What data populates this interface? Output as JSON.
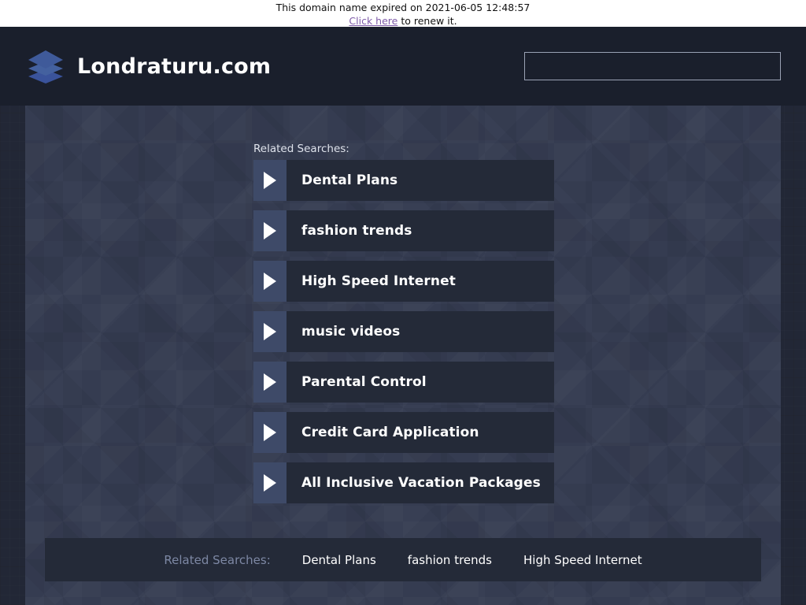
{
  "notice": {
    "message": "This domain name expired on 2021-06-05 12:48:57",
    "link_text": "Click here",
    "after_link_text": " to renew it."
  },
  "header": {
    "logo_icon": "stacked-layers-icon",
    "site_title": "Londraturu.com",
    "search": {
      "value": "",
      "placeholder": ""
    }
  },
  "main": {
    "related_label": "Related Searches:",
    "results": [
      {
        "label": "Dental Plans",
        "icon": "play-triangle-icon"
      },
      {
        "label": "fashion trends",
        "icon": "play-triangle-icon"
      },
      {
        "label": "High Speed Internet",
        "icon": "play-triangle-icon"
      },
      {
        "label": "music videos",
        "icon": "play-triangle-icon"
      },
      {
        "label": "Parental Control",
        "icon": "play-triangle-icon"
      },
      {
        "label": "Credit Card Application",
        "icon": "play-triangle-icon"
      },
      {
        "label": "All Inclusive Vacation Packages",
        "icon": "play-triangle-icon"
      }
    ]
  },
  "footer": {
    "related_label": "Related Searches:",
    "links": [
      "Dental Plans",
      "fashion trends",
      "High Speed Internet"
    ]
  },
  "colors": {
    "notice_bg": "#ffffff",
    "notice_link": "#7d5aa8",
    "header_bg": "#1a1f2c",
    "content_bg": "#353c51",
    "item_body_bg": "#242a38",
    "item_arrow_bg": "#3e4a68",
    "text_white": "#ffffff",
    "footer_label": "#7d88a4",
    "logo_blue": "#3f5a9a"
  }
}
